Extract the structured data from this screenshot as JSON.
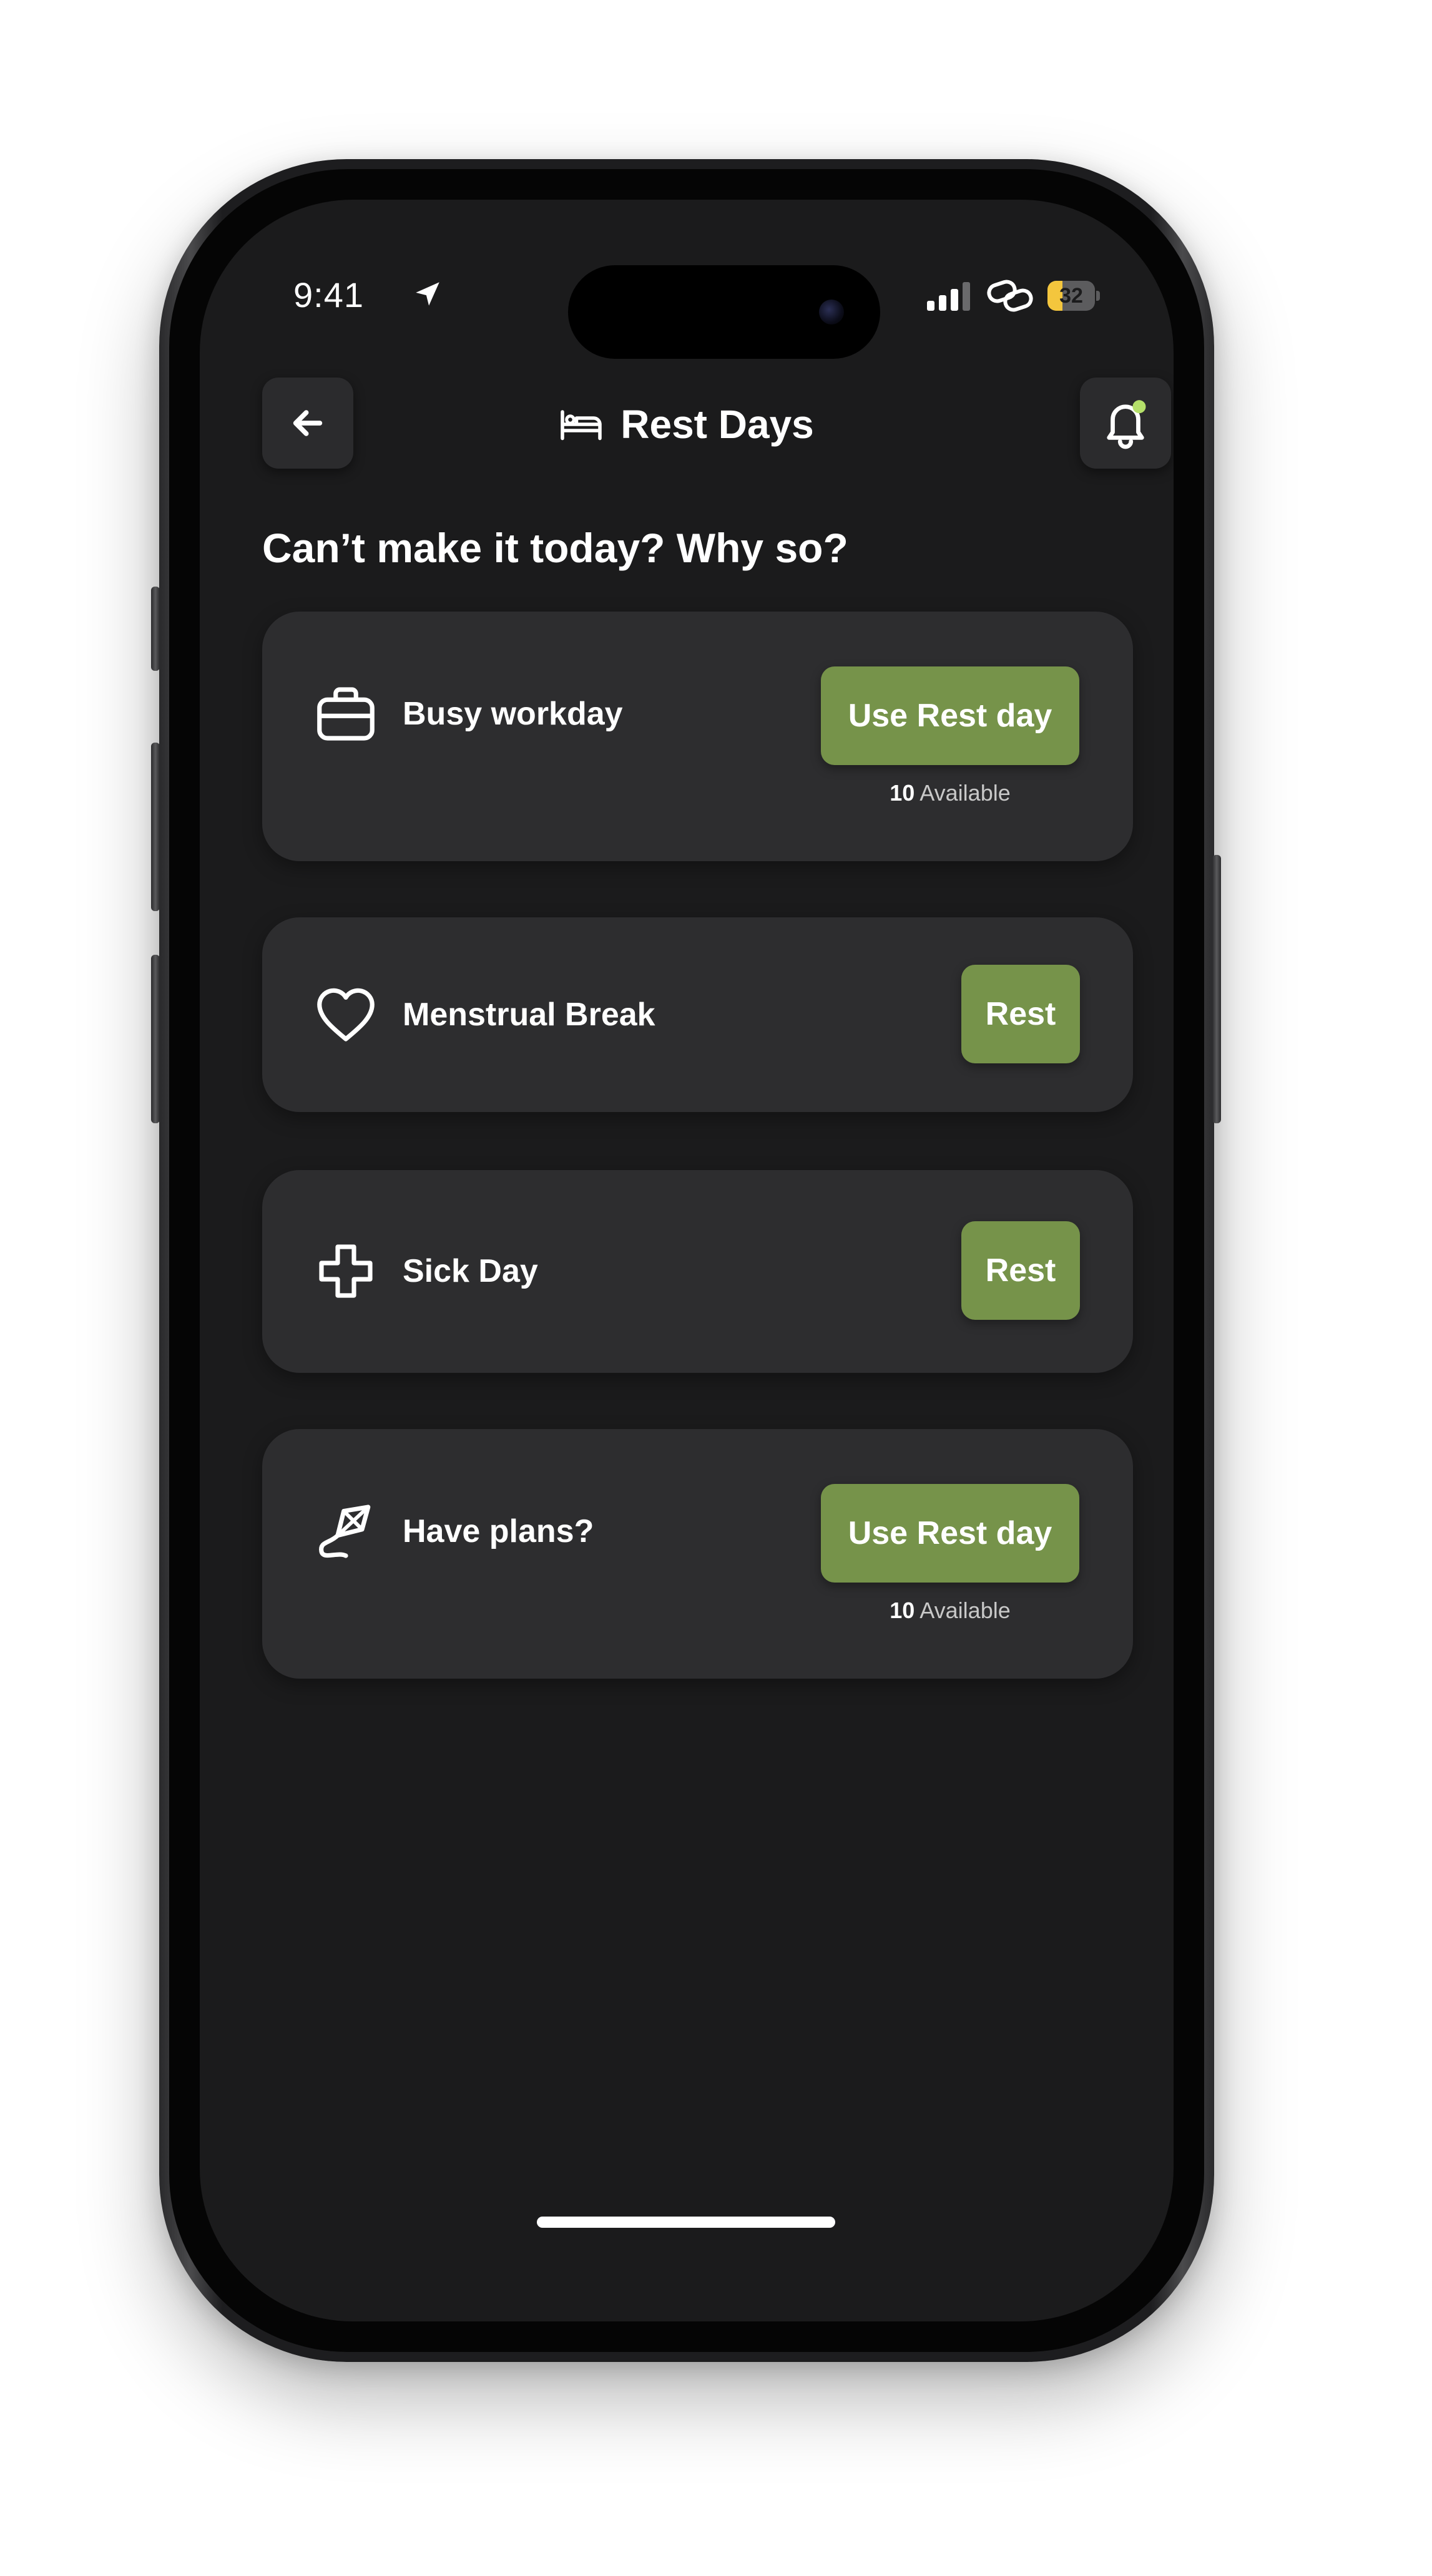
{
  "status_bar": {
    "time": "9:41",
    "battery_level": "32",
    "battery_fraction": 0.32,
    "location_icon": "location-arrow-icon",
    "signal_icon": "cellular-signal-icon",
    "link_icon": "link-icon"
  },
  "header": {
    "title": "Rest Days",
    "title_icon": "bed-icon",
    "back_icon": "arrow-left-icon",
    "bell_icon": "bell-icon"
  },
  "question": "Can’t make it today? Why so?",
  "cards": [
    {
      "label": "Busy workday",
      "icon": "briefcase-icon",
      "button_label": "Use Rest day",
      "available_count": "10",
      "available_text": "Available"
    },
    {
      "label": "Menstrual Break",
      "icon": "heart-icon",
      "button_label": "Rest"
    },
    {
      "label": "Sick Day",
      "icon": "medical-cross-icon",
      "button_label": "Rest"
    },
    {
      "label": "Have plans?",
      "icon": "kite-icon",
      "button_label": "Use Rest day",
      "available_count": "10",
      "available_text": "Available"
    }
  ],
  "colors": {
    "background": "#1b1b1c",
    "card": "#2d2d2f",
    "accent_green": "#76934a",
    "notification_dot": "#b5e06a",
    "battery_yellow": "#f4c63d",
    "text": "#ffffff"
  }
}
